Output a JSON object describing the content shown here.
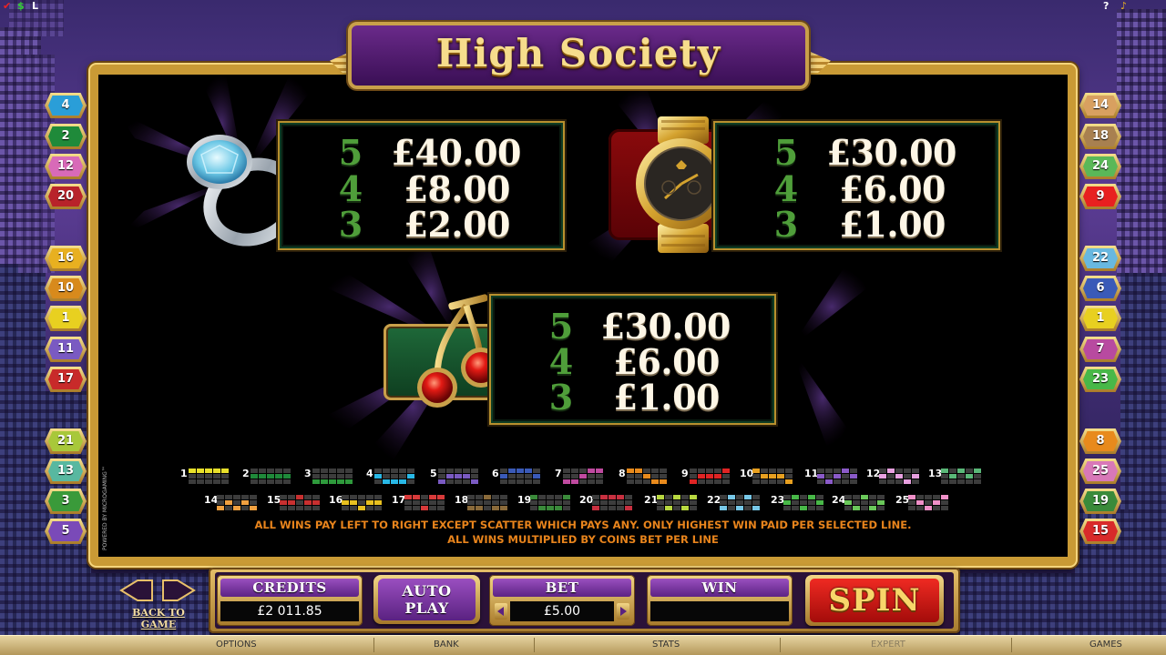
{
  "title": "High Society",
  "paytable": [
    {
      "symbol": "diamond-ring",
      "rows": [
        {
          "count": "5",
          "amount": "£40.00"
        },
        {
          "count": "4",
          "amount": "£8.00"
        },
        {
          "count": "3",
          "amount": "£2.00"
        }
      ]
    },
    {
      "symbol": "gold-watch",
      "rows": [
        {
          "count": "5",
          "amount": "£30.00"
        },
        {
          "count": "4",
          "amount": "£6.00"
        },
        {
          "count": "3",
          "amount": "£1.00"
        }
      ]
    },
    {
      "symbol": "cherries",
      "rows": [
        {
          "count": "5",
          "amount": "£30.00"
        },
        {
          "count": "4",
          "amount": "£6.00"
        },
        {
          "count": "3",
          "amount": "£1.00"
        }
      ]
    }
  ],
  "paylines": [
    {
      "n": "1",
      "color": "#e8e02a",
      "rows": [
        0,
        0,
        0,
        0,
        0
      ]
    },
    {
      "n": "2",
      "color": "#1f8a3a",
      "rows": [
        1,
        1,
        1,
        1,
        1
      ]
    },
    {
      "n": "3",
      "color": "#2e9a3c",
      "rows": [
        2,
        2,
        2,
        2,
        2
      ]
    },
    {
      "n": "4",
      "color": "#28b8e6",
      "rows": [
        1,
        2,
        2,
        2,
        1
      ]
    },
    {
      "n": "5",
      "color": "#7a5ac2",
      "rows": [
        2,
        1,
        1,
        1,
        2
      ]
    },
    {
      "n": "6",
      "color": "#3a5ab8",
      "rows": [
        1,
        0,
        0,
        0,
        1
      ]
    },
    {
      "n": "7",
      "color": "#c04aa0",
      "rows": [
        2,
        2,
        1,
        0,
        0
      ]
    },
    {
      "n": "8",
      "color": "#e88a1c",
      "rows": [
        0,
        0,
        1,
        2,
        2
      ]
    },
    {
      "n": "9",
      "color": "#e02424",
      "rows": [
        2,
        1,
        1,
        1,
        0
      ]
    },
    {
      "n": "10",
      "color": "#e8a020",
      "rows": [
        0,
        1,
        1,
        1,
        2
      ]
    },
    {
      "n": "11",
      "color": "#8a5ac8",
      "rows": [
        1,
        2,
        1,
        0,
        1
      ]
    },
    {
      "n": "12",
      "color": "#e8a0e0",
      "rows": [
        1,
        0,
        1,
        2,
        1
      ]
    },
    {
      "n": "13",
      "color": "#5ab878",
      "rows": [
        0,
        1,
        0,
        1,
        0
      ]
    },
    {
      "n": "14",
      "color": "#f0a040",
      "rows": [
        2,
        1,
        2,
        1,
        2
      ]
    },
    {
      "n": "15",
      "color": "#c83030",
      "rows": [
        1,
        1,
        0,
        1,
        1
      ]
    },
    {
      "n": "16",
      "color": "#e8c020",
      "rows": [
        1,
        1,
        2,
        1,
        1
      ]
    },
    {
      "n": "17",
      "color": "#d83a3a",
      "rows": [
        0,
        0,
        2,
        0,
        0
      ]
    },
    {
      "n": "18",
      "color": "#8a6a3a",
      "rows": [
        2,
        2,
        0,
        2,
        2
      ]
    },
    {
      "n": "19",
      "color": "#3a8a3a",
      "rows": [
        0,
        2,
        2,
        2,
        0
      ]
    },
    {
      "n": "20",
      "color": "#c83040",
      "rows": [
        2,
        0,
        0,
        0,
        2
      ]
    },
    {
      "n": "21",
      "color": "#b8d840",
      "rows": [
        0,
        2,
        0,
        2,
        0
      ]
    },
    {
      "n": "22",
      "color": "#78c8e8",
      "rows": [
        2,
        0,
        2,
        0,
        2
      ]
    },
    {
      "n": "23",
      "color": "#48b848",
      "rows": [
        1,
        0,
        2,
        0,
        1
      ]
    },
    {
      "n": "24",
      "color": "#6ac85a",
      "rows": [
        1,
        2,
        0,
        2,
        1
      ]
    },
    {
      "n": "25",
      "color": "#f090c8",
      "rows": [
        0,
        1,
        2,
        1,
        0
      ]
    }
  ],
  "rules_line1": "ALL WINS PAY LEFT TO RIGHT EXCEPT SCATTER WHICH PAYS ANY. ONLY HIGHEST WIN PAID PER SELECTED LINE.",
  "rules_line2": "ALL WINS MULTIPLIED BY COINS BET PER LINE",
  "powered_by": "POWERED BY MICROGAMING™",
  "left_markers": [
    {
      "n": "4",
      "color": "#2a9ed8"
    },
    {
      "n": "2",
      "color": "#1f8a3a"
    },
    {
      "n": "12",
      "color": "#d86ab8"
    },
    {
      "n": "20",
      "color": "#b8232a"
    },
    {
      "n": "16",
      "color": "#e8b020"
    },
    {
      "n": "10",
      "color": "#d88a1c"
    },
    {
      "n": "1",
      "color": "#e8d020"
    },
    {
      "n": "11",
      "color": "#7a5ac2"
    },
    {
      "n": "17",
      "color": "#c82a2a"
    },
    {
      "n": "21",
      "color": "#a8c83a"
    },
    {
      "n": "13",
      "color": "#58b8a0"
    },
    {
      "n": "3",
      "color": "#3a9a3a"
    },
    {
      "n": "5",
      "color": "#7a4ab8"
    }
  ],
  "right_markers": [
    {
      "n": "14",
      "color": "#d8a060"
    },
    {
      "n": "18",
      "color": "#a88050"
    },
    {
      "n": "24",
      "color": "#5ab858"
    },
    {
      "n": "9",
      "color": "#e82020"
    },
    {
      "n": "22",
      "color": "#68b8e0"
    },
    {
      "n": "6",
      "color": "#3a5ab8"
    },
    {
      "n": "1",
      "color": "#e8d020"
    },
    {
      "n": "7",
      "color": "#b84aa0"
    },
    {
      "n": "23",
      "color": "#48b848"
    },
    {
      "n": "8",
      "color": "#e88a1c"
    },
    {
      "n": "25",
      "color": "#d878b8"
    },
    {
      "n": "19",
      "color": "#3a8a3a"
    },
    {
      "n": "15",
      "color": "#d82a2a"
    }
  ],
  "console": {
    "credits_label": "CREDITS",
    "credits_value": "£2 011.85",
    "auto_play_line1": "AUTO",
    "auto_play_line2": "PLAY",
    "bet_label": "BET",
    "bet_value": "£5.00",
    "win_label": "WIN",
    "win_value": "",
    "spin_label": "SPIN"
  },
  "back_to_game": "BACK TO GAME",
  "status_bar": [
    "OPTIONS",
    "BANK",
    "STATS",
    "EXPERT",
    "GAMES"
  ],
  "top_icons": [
    "cashier-icon",
    "dollar-icon",
    "bars-icon",
    "help-icon",
    "sound-icon"
  ]
}
